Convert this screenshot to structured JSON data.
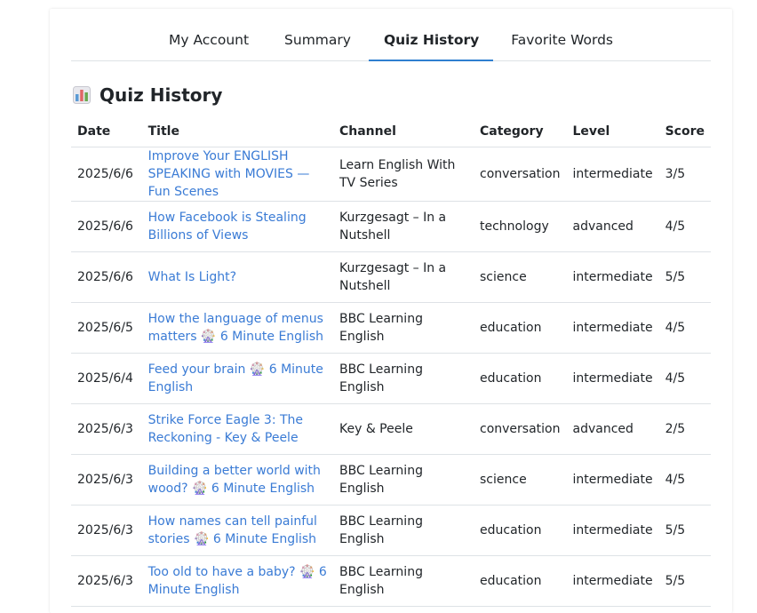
{
  "tabs": [
    {
      "label": "My Account",
      "active": false
    },
    {
      "label": "Summary",
      "active": false
    },
    {
      "label": "Quiz History",
      "active": true
    },
    {
      "label": "Favorite Words",
      "active": false
    }
  ],
  "section": {
    "icon": "bar-chart-icon",
    "title": "Quiz History"
  },
  "table": {
    "headers": {
      "date": "Date",
      "title": "Title",
      "channel": "Channel",
      "category": "Category",
      "level": "Level",
      "score": "Score"
    },
    "rows": [
      {
        "date": "2025/6/6",
        "title": "Improve Your ENGLISH SPEAKING with MOVIES — Fun Scenes",
        "channel": "Learn English With TV Series",
        "category": "conversation",
        "level": "intermediate",
        "score": "3/5"
      },
      {
        "date": "2025/6/6",
        "title": "How Facebook is Stealing Billions of Views",
        "channel": "Kurzgesagt – In a Nutshell",
        "category": "technology",
        "level": "advanced",
        "score": "4/5"
      },
      {
        "date": "2025/6/6",
        "title": "What Is Light?",
        "channel": "Kurzgesagt – In a Nutshell",
        "category": "science",
        "level": "intermediate",
        "score": "5/5"
      },
      {
        "date": "2025/6/5",
        "title": "How the language of menus matters 🎡 6 Minute English",
        "channel": "BBC Learning English",
        "category": "education",
        "level": "intermediate",
        "score": "4/5"
      },
      {
        "date": "2025/6/4",
        "title": "Feed your brain 🎡 6 Minute English",
        "channel": "BBC Learning English",
        "category": "education",
        "level": "intermediate",
        "score": "4/5"
      },
      {
        "date": "2025/6/3",
        "title": "Strike Force Eagle 3: The Reckoning - Key & Peele",
        "channel": "Key & Peele",
        "category": "conversation",
        "level": "advanced",
        "score": "2/5"
      },
      {
        "date": "2025/6/3",
        "title": "Building a better world with wood? 🎡 6 Minute English",
        "channel": "BBC Learning English",
        "category": "science",
        "level": "intermediate",
        "score": "4/5"
      },
      {
        "date": "2025/6/3",
        "title": "How names can tell painful stories 🎡 6 Minute English",
        "channel": "BBC Learning English",
        "category": "education",
        "level": "intermediate",
        "score": "5/5"
      },
      {
        "date": "2025/6/3",
        "title": "Too old to have a baby? 🎡 6 Minute English",
        "channel": "BBC Learning English",
        "category": "education",
        "level": "intermediate",
        "score": "5/5"
      }
    ]
  },
  "colors": {
    "accent": "#2f7fd0",
    "link": "#3a7bd5",
    "border": "#dee2e6",
    "text": "#212529"
  }
}
